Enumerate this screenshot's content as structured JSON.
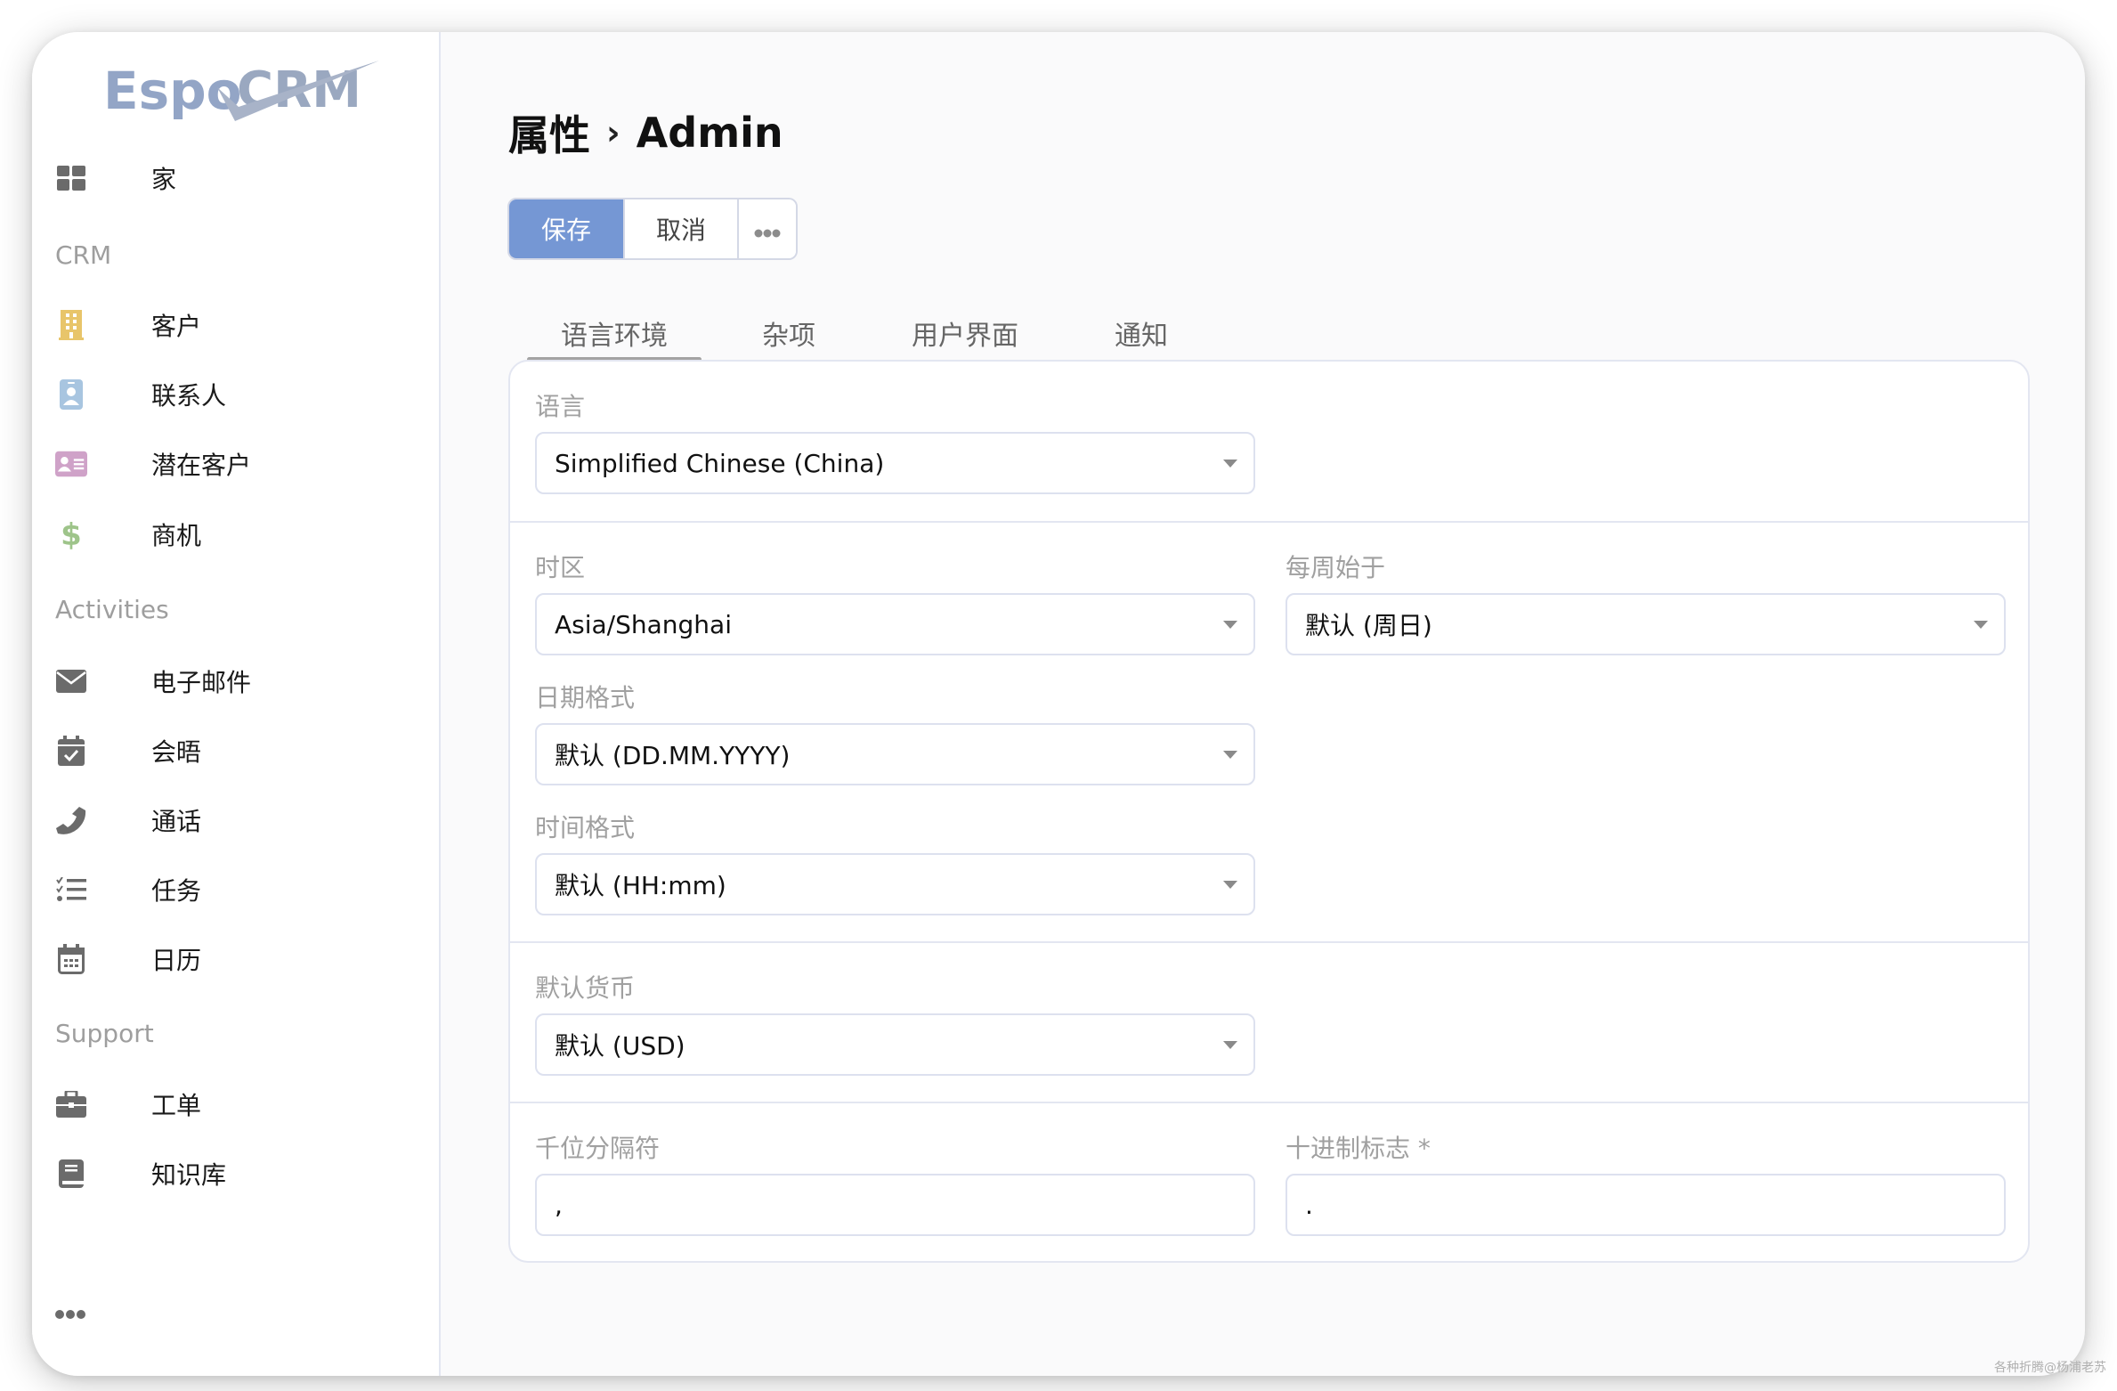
{
  "app": {
    "logo_text_a": "Espo",
    "logo_text_b": "CRM",
    "brand_color": "#93a5c6"
  },
  "sidebar": {
    "items": [
      {
        "id": "home",
        "label": "家",
        "icon": "grid-icon",
        "color": "#6b6b6b"
      },
      {
        "group": "CRM"
      },
      {
        "id": "accounts",
        "label": "客户",
        "icon": "building-icon",
        "color": "#e8c56a"
      },
      {
        "id": "contacts",
        "label": "联系人",
        "icon": "id-badge-icon",
        "color": "#a8c5e0"
      },
      {
        "id": "leads",
        "label": "潜在客户",
        "icon": "address-card-icon",
        "color": "#cfa2c8"
      },
      {
        "id": "opportunities",
        "label": "商机",
        "icon": "dollar-icon",
        "color": "#9ec48a"
      },
      {
        "group": "Activities"
      },
      {
        "id": "emails",
        "label": "电子邮件",
        "icon": "envelope-icon",
        "color": "#6b6b6b"
      },
      {
        "id": "meetings",
        "label": "会晤",
        "icon": "calendar-check-icon",
        "color": "#6b6b6b"
      },
      {
        "id": "calls",
        "label": "通话",
        "icon": "phone-icon",
        "color": "#6b6b6b"
      },
      {
        "id": "tasks",
        "label": "任务",
        "icon": "task-list-icon",
        "color": "#6b6b6b"
      },
      {
        "id": "calendar",
        "label": "日历",
        "icon": "calendar-icon",
        "color": "#6b6b6b"
      },
      {
        "group": "Support"
      },
      {
        "id": "cases",
        "label": "工单",
        "icon": "briefcase-icon",
        "color": "#6b6b6b"
      },
      {
        "id": "knowledge-base",
        "label": "知识库",
        "icon": "book-icon",
        "color": "#6b6b6b"
      }
    ],
    "groups": {
      "crm": "CRM",
      "activities": "Activities",
      "support": "Support"
    },
    "labels": {
      "home": "家",
      "accounts": "客户",
      "contacts": "联系人",
      "leads": "潜在客户",
      "opportunities": "商机",
      "emails": "电子邮件",
      "meetings": "会晤",
      "calls": "通话",
      "tasks": "任务",
      "calendar": "日历",
      "cases": "工单",
      "knowledge_base": "知识库"
    }
  },
  "header": {
    "breadcrumb_root": "属性",
    "separator": "›",
    "breadcrumb_current": "Admin"
  },
  "toolbar": {
    "save_label": "保存",
    "cancel_label": "取消",
    "more_icon": "ellipsis-icon",
    "save_color": "#7597d4"
  },
  "tabs": [
    {
      "label": "语言环境",
      "active": true
    },
    {
      "label": "杂项",
      "active": false
    },
    {
      "label": "用户界面",
      "active": false
    },
    {
      "label": "通知",
      "active": false
    }
  ],
  "form": {
    "language": {
      "label": "语言",
      "value": "Simplified Chinese (China)"
    },
    "time_zone": {
      "label": "时区",
      "value": "Asia/Shanghai"
    },
    "week_start": {
      "label": "每周始于",
      "value": "默认 (周日)"
    },
    "date_format": {
      "label": "日期格式",
      "value": "默认 (DD.MM.YYYY)"
    },
    "time_format": {
      "label": "时间格式",
      "value": "默认 (HH:mm)"
    },
    "default_currency": {
      "label": "默认货币",
      "value": "默认 (USD)"
    },
    "thousand_separator": {
      "label": "千位分隔符",
      "value": ","
    },
    "decimal_mark": {
      "label": "十进制标志 *",
      "value": "."
    }
  },
  "watermark": "各种折腾@杨浦老苏"
}
